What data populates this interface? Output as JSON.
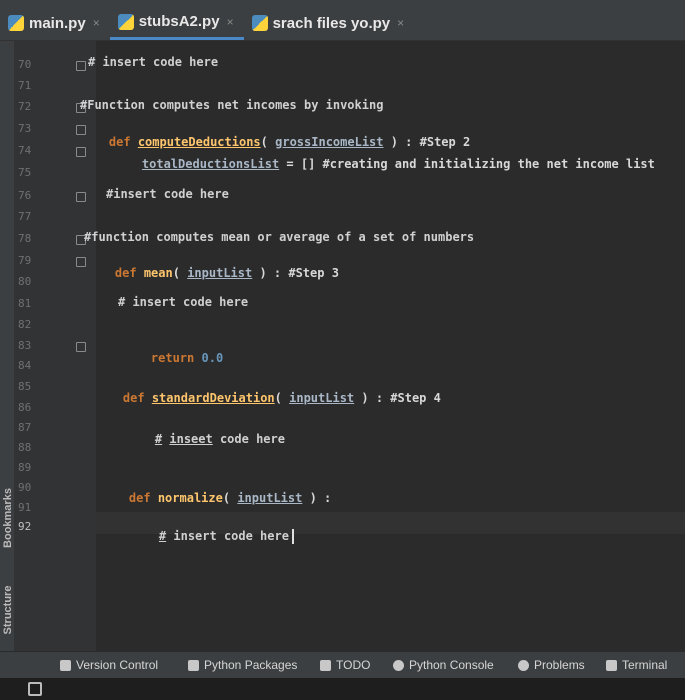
{
  "tabs": [
    {
      "label": "main.py",
      "close": "×"
    },
    {
      "label": "stubsA2.py",
      "close": "×"
    },
    {
      "label": "srach files yo.py",
      "close": "×"
    }
  ],
  "tool_windows": {
    "bookmarks": "Bookmarks",
    "structure": "Structure"
  },
  "line_numbers": [
    "70",
    "71",
    "72",
    "73",
    "74",
    "75",
    "76",
    "77",
    "78",
    "79",
    "80",
    "81",
    "82",
    "83",
    "84",
    "85",
    "86",
    "87",
    "88",
    "89",
    "90",
    "91",
    "92"
  ],
  "code": {
    "l70": "# insert code here",
    "l72": "#Function computes net incomes by invoking",
    "l73_kw": "def",
    "l73_fn": "computeDeductions",
    "l73_open": "(",
    "l73_param": "grossIncomeList",
    "l73_tail": " ) : #Step 2",
    "l74_var": "totalDeductionsList",
    "l74_tail": " = [] #creating and initializing the net income list",
    "l76": "#insert code here",
    "l78": "#function computes mean or average of a set of numbers",
    "l79_kw": "def",
    "l79_fn": "mean",
    "l79_open": "(",
    "l79_param": "inputList",
    "l79_tail": " ) : #Step 3",
    "l81": "# insert code here",
    "l83_kw": "return",
    "l83_num": "0.0",
    "l85_kw": "def",
    "l85_fn": "standardDeviation",
    "l85_open": "(",
    "l85_param": "inputList",
    "l85_tail": " ) : #Step 4",
    "l87_hash": "#",
    "l87_word": "inseet",
    "l87_tail": " code here",
    "l90_kw": "def",
    "l90_fn": "normalize",
    "l90_open": "(",
    "l90_param": "inputList",
    "l90_tail": " ) :",
    "l92_hash": "#",
    "l92_tail": " insert code here"
  },
  "statusbar": {
    "version_control": "Version Control",
    "python_packages": "Python Packages",
    "todo": "TODO",
    "python_console": "Python Console",
    "problems": "Problems",
    "terminal": "Terminal"
  }
}
